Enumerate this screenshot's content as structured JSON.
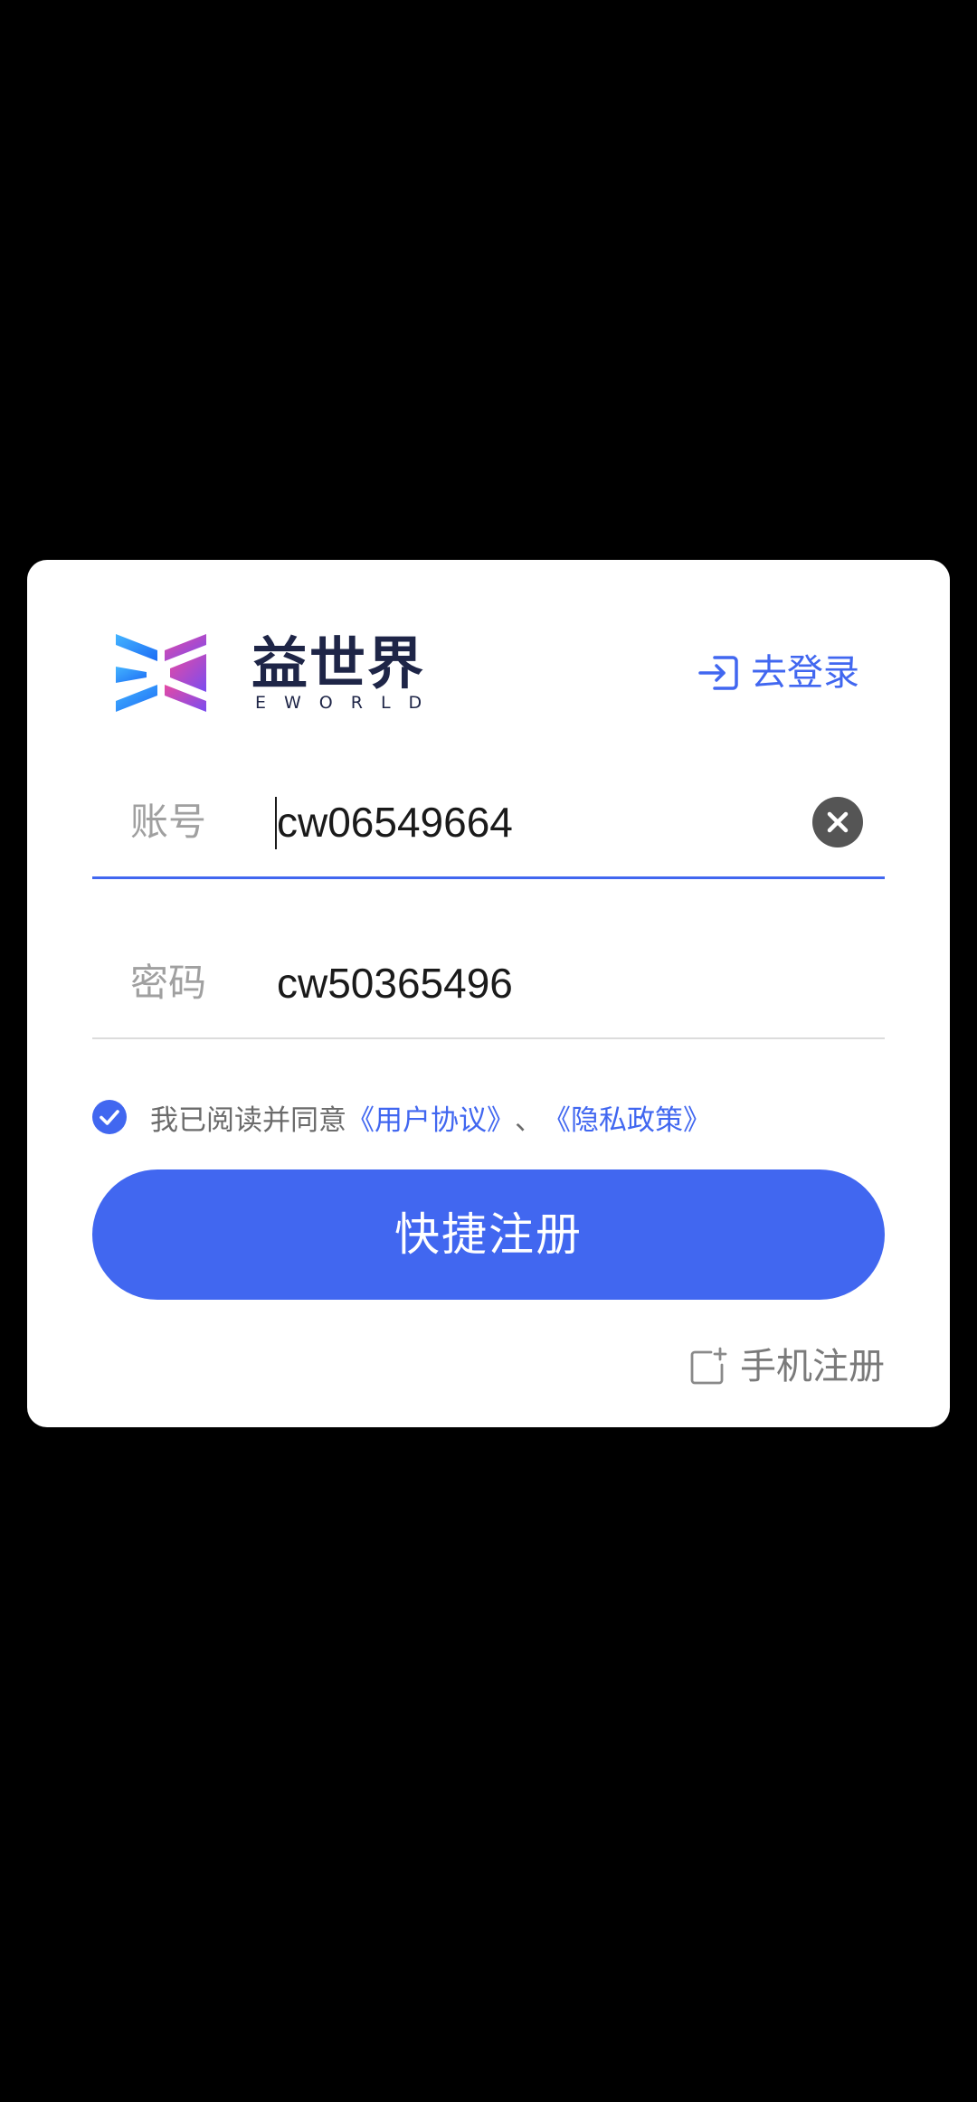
{
  "brand": {
    "name_cn": "益世界",
    "name_en": "EWORLD",
    "colors": {
      "text": "#1e2547",
      "left_gradient": [
        "#3ba8ff",
        "#1d6cf5"
      ],
      "right_gradient": [
        "#e54aa3",
        "#7a4cf0"
      ]
    }
  },
  "header": {
    "login_link_label": "去登录",
    "login_icon": "login-arrow-icon"
  },
  "form": {
    "account": {
      "label": "账号",
      "value": "cw06549664",
      "clear_icon": "clear-icon"
    },
    "password": {
      "label": "密码",
      "value": "cw50365496"
    }
  },
  "agreement": {
    "checked": true,
    "prefix": "我已阅读并同意",
    "user_agreement": "《用户协议》",
    "separator": "、",
    "privacy_policy": "《隐私政策》"
  },
  "actions": {
    "quick_register_label": "快捷注册",
    "phone_register_label": "手机注册",
    "phone_register_icon": "add-square-icon"
  },
  "colors": {
    "accent": "#4167f0",
    "background": "#000000",
    "dialog": "#ffffff",
    "placeholder_label": "#a0a0a0"
  }
}
